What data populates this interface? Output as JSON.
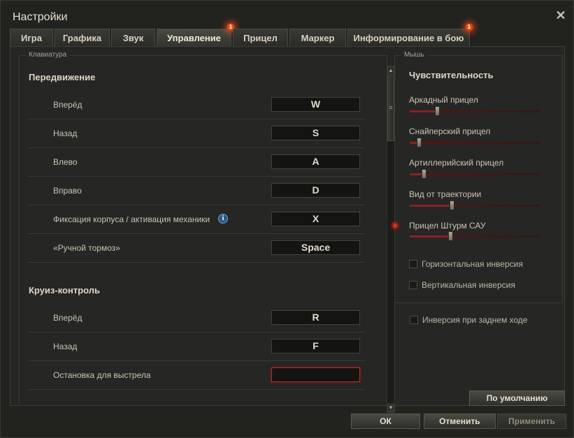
{
  "window": {
    "title": "Настройки"
  },
  "tabs": [
    {
      "label": "Игра",
      "active": false,
      "badge": ""
    },
    {
      "label": "Графика",
      "active": false,
      "badge": ""
    },
    {
      "label": "Звук",
      "active": false,
      "badge": ""
    },
    {
      "label": "Управление",
      "active": true,
      "badge": "1"
    },
    {
      "label": "Прицел",
      "active": false,
      "badge": ""
    },
    {
      "label": "Маркер",
      "active": false,
      "badge": ""
    },
    {
      "label": "Информирование в бою",
      "active": false,
      "badge": "1"
    }
  ],
  "keyboard": {
    "legend": "Клавиатура",
    "sections": [
      {
        "title": "Передвижение",
        "rows": [
          {
            "label": "Вперёд",
            "key": "W"
          },
          {
            "label": "Назад",
            "key": "S"
          },
          {
            "label": "Влево",
            "key": "A"
          },
          {
            "label": "Вправо",
            "key": "D"
          },
          {
            "label": "Фиксация корпуса / активация механики",
            "key": "X",
            "info": true
          },
          {
            "label": "«Ручной тормоз»",
            "key": "Space"
          }
        ]
      },
      {
        "title": "Круиз-контроль",
        "rows": [
          {
            "label": "Вперёд",
            "key": "R"
          },
          {
            "label": "Назад",
            "key": "F"
          },
          {
            "label": "Остановка для выстрела",
            "key": "",
            "active": true
          }
        ]
      }
    ]
  },
  "mouse": {
    "legend": "Мышь",
    "sensitivity_title": "Чувствительность",
    "sliders": [
      {
        "label": "Аркадный прицел",
        "value": 0.21
      },
      {
        "label": "Снайперский прицел",
        "value": 0.07
      },
      {
        "label": "Артиллерийский прицел",
        "value": 0.11
      },
      {
        "label": "Вид от траектории",
        "value": 0.32,
        "highlight": true
      },
      {
        "label": "Прицел Штурм САУ",
        "value": 0.31,
        "highlight": true
      }
    ],
    "checkboxes": [
      {
        "label": "Горизонтальная инверсия",
        "checked": false
      },
      {
        "label": "Вертикальная инверсия",
        "checked": false
      }
    ]
  },
  "reverse_inversion": {
    "label": "Инверсия при заднем ходе",
    "checked": false
  },
  "buttons": {
    "defaults": "По умолчанию",
    "ok": "ОК",
    "cancel": "Отменить",
    "apply": "Применить"
  },
  "icons": {
    "close": "close-icon",
    "info": "info-icon",
    "scroll_up": "chevron-up-icon",
    "scroll_down": "chevron-down-icon"
  },
  "colors": {
    "background": "#22221f",
    "accent_red": "#c0262a",
    "badge": "#e0461a",
    "info_blue": "#2b5a8a"
  }
}
